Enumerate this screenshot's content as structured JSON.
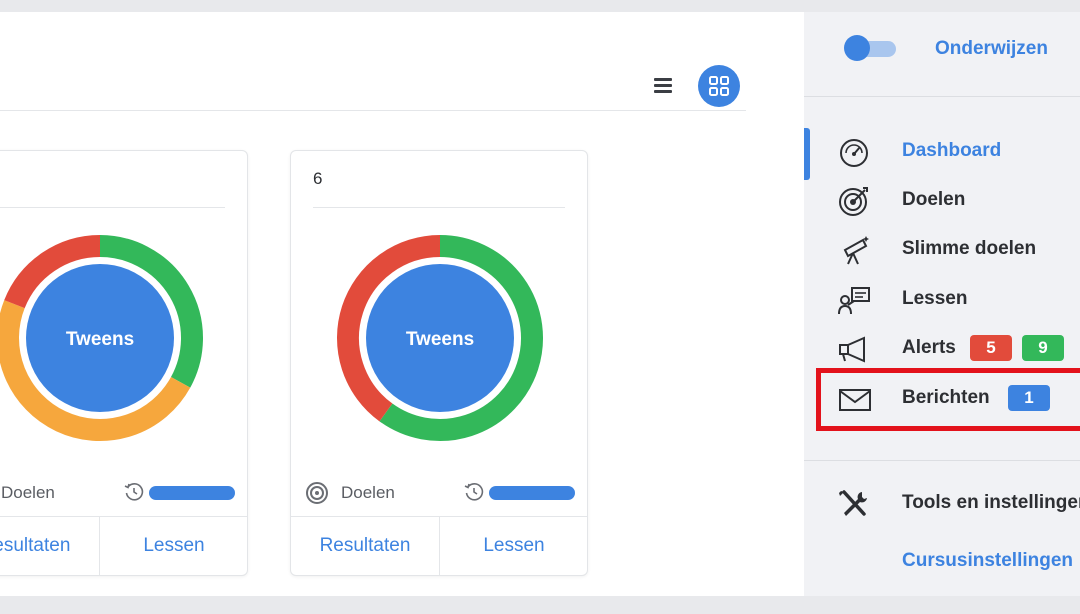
{
  "colors": {
    "accent": "#3d83e0",
    "green": "#33b85a",
    "red": "#e24b3b",
    "orange": "#f6a73d",
    "badge_red": "#e24b3b",
    "badge_green": "#33b85a",
    "badge_blue": "#3d83e0",
    "highlight": "#e3121b"
  },
  "toolbar": {
    "list_icon": "menu-icon",
    "grid_icon": "grid-icon"
  },
  "cards": [
    {
      "number": "",
      "center_label": "Tweens",
      "segments": [
        {
          "color": "green",
          "fraction": 0.33
        },
        {
          "color": "orange",
          "fraction": 0.48
        },
        {
          "color": "red",
          "fraction": 0.19
        }
      ],
      "goals_label": "Doelen",
      "results_label": "Resultaten",
      "lessons_label": "Lessen"
    },
    {
      "number": "6",
      "center_label": "Tweens",
      "segments": [
        {
          "color": "green",
          "fraction": 0.6
        },
        {
          "color": "red",
          "fraction": 0.4
        }
      ],
      "goals_label": "Doelen",
      "results_label": "Resultaten",
      "lessons_label": "Lessen"
    }
  ],
  "sidebar": {
    "mode_label": "Onderwijzen",
    "items": [
      {
        "label": "Dashboard",
        "icon": "dashboard-gauge-icon",
        "active": true
      },
      {
        "label": "Doelen",
        "icon": "target-icon"
      },
      {
        "label": "Slimme doelen",
        "icon": "telescope-icon"
      },
      {
        "label": "Lessen",
        "icon": "presentation-icon"
      },
      {
        "label": "Alerts",
        "icon": "megaphone-icon",
        "badges": [
          {
            "text": "5",
            "color": "red"
          },
          {
            "text": "9",
            "color": "green"
          }
        ]
      },
      {
        "label": "Berichten",
        "icon": "envelope-icon",
        "badges": [
          {
            "text": "1",
            "color": "blue"
          }
        ]
      }
    ],
    "tools_label": "Tools en instellingen",
    "course_settings_label": "Cursusinstellingen"
  }
}
